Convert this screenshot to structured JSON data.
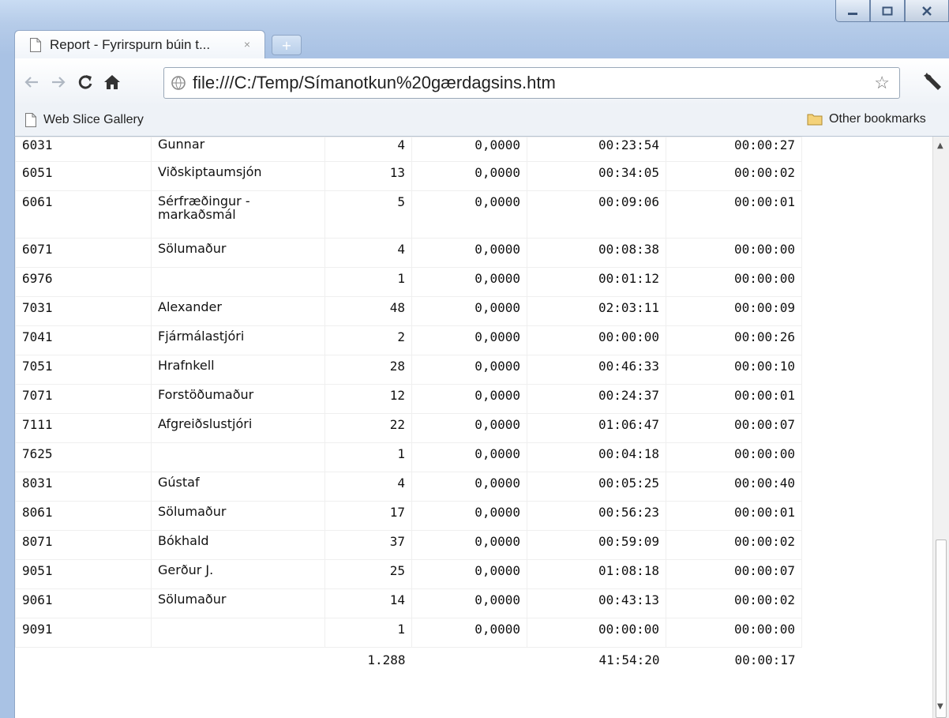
{
  "tab": {
    "title": "Report - Fyrirspurn búin t...",
    "close": "×",
    "new_tab": "+"
  },
  "omnibox": {
    "url": "file:///C:/Temp/Símanotkun%20gærdagsins.htm"
  },
  "bookmarks": {
    "left": "Web Slice Gallery",
    "right": "Other bookmarks"
  },
  "icons": [
    "page-icon",
    "back-icon",
    "forward-icon",
    "reload-icon",
    "home-icon",
    "globe-icon",
    "star-icon",
    "wrench-icon",
    "folder-icon",
    "minimize-icon",
    "maximize-icon",
    "close-icon"
  ],
  "table": {
    "rows": [
      [
        "6031",
        "Gunnar",
        "4",
        "0,0000",
        "00:23:54",
        "00:00:27"
      ],
      [
        "6051",
        "Viðskiptaumsjón",
        "13",
        "0,0000",
        "00:34:05",
        "00:00:02"
      ],
      [
        "6061",
        "Sérfræðingur - markaðsmál",
        "5",
        "0,0000",
        "00:09:06",
        "00:00:01"
      ],
      [
        "6071",
        "Sölumaður",
        "4",
        "0,0000",
        "00:08:38",
        "00:00:00"
      ],
      [
        "6976",
        "",
        "1",
        "0,0000",
        "00:01:12",
        "00:00:00"
      ],
      [
        "7031",
        "Alexander",
        "48",
        "0,0000",
        "02:03:11",
        "00:00:09"
      ],
      [
        "7041",
        "Fjármálastjóri",
        "2",
        "0,0000",
        "00:00:00",
        "00:00:26"
      ],
      [
        "7051",
        "Hrafnkell",
        "28",
        "0,0000",
        "00:46:33",
        "00:00:10"
      ],
      [
        "7071",
        "Forstöðumaður",
        "12",
        "0,0000",
        "00:24:37",
        "00:00:01"
      ],
      [
        "7111",
        "Afgreiðslustjóri",
        "22",
        "0,0000",
        "01:06:47",
        "00:00:07"
      ],
      [
        "7625",
        "",
        "1",
        "0,0000",
        "00:04:18",
        "00:00:00"
      ],
      [
        "8031",
        "Gústaf",
        "4",
        "0,0000",
        "00:05:25",
        "00:00:40"
      ],
      [
        "8061",
        "Sölumaður",
        "17",
        "0,0000",
        "00:56:23",
        "00:00:01"
      ],
      [
        "8071",
        "Bókhald",
        "37",
        "0,0000",
        "00:59:09",
        "00:00:02"
      ],
      [
        "9051",
        "Gerður J.",
        "25",
        "0,0000",
        "01:08:18",
        "00:00:07"
      ],
      [
        "9061",
        "Sölumaður",
        "14",
        "0,0000",
        "00:43:13",
        "00:00:02"
      ],
      [
        "9091",
        "",
        "1",
        "0,0000",
        "00:00:00",
        "00:00:00"
      ]
    ],
    "totals": {
      "count": "1.288",
      "duration": "41:54:20",
      "avg": "00:00:17"
    }
  }
}
